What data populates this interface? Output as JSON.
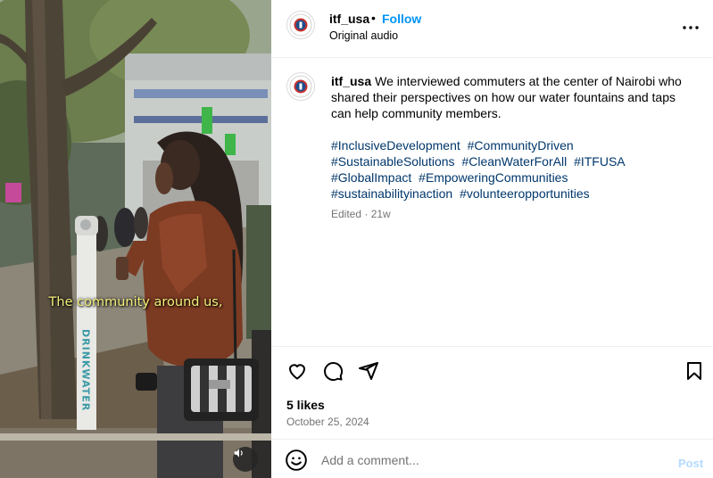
{
  "video": {
    "caption": "The community around us,",
    "pole_label": "DRINKWATER",
    "mute_icon": "speaker-icon"
  },
  "header": {
    "username": "itf_usa",
    "separator": "•",
    "follow_label": "Follow",
    "subtitle": "Original audio",
    "more_icon": "more-horizontal-icon"
  },
  "post": {
    "username": "itf_usa",
    "text": "We interviewed commuters at the center of Nairobi who shared their perspectives on how our water fountains and taps can help community members.",
    "hashtags": [
      "#InclusiveDevelopment",
      "#CommunityDriven",
      "#SustainableSolutions",
      "#CleanWaterForAll",
      "#ITFUSA",
      "#GlobalImpact",
      "#EmpoweringCommunities",
      "#sustainabilityinaction",
      "#volunteeropportunities"
    ],
    "meta": "Edited · 21w"
  },
  "actions": {
    "likes": "5 likes",
    "date": "October 25, 2024"
  },
  "comment": {
    "placeholder": "Add a comment...",
    "post_label": "Post"
  },
  "colors": {
    "accent": "#0095f6",
    "hashtag": "#00376b",
    "muted": "#737373",
    "post_disabled": "#b3dbff",
    "caption_yellow": "#f3ef7a"
  }
}
